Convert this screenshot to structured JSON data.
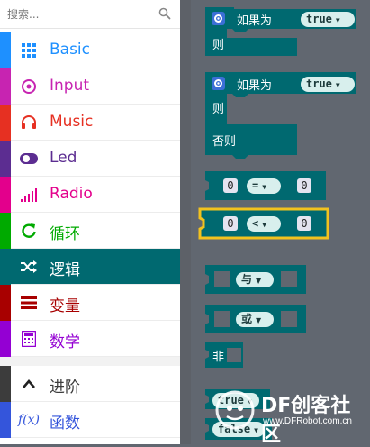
{
  "search": {
    "placeholder": "搜索..."
  },
  "categories": [
    {
      "label": "Basic",
      "color": "#1e90ff",
      "icon": "grid-icon"
    },
    {
      "label": "Input",
      "color": "#c724b1",
      "icon": "target-icon"
    },
    {
      "label": "Music",
      "color": "#e63022",
      "icon": "headphones-icon"
    },
    {
      "label": "Led",
      "color": "#5c2d91",
      "icon": "toggle-icon"
    },
    {
      "label": "Radio",
      "color": "#e3008c",
      "icon": "signal-icon"
    },
    {
      "label": "循环",
      "color": "#00aa00",
      "icon": "refresh-icon"
    },
    {
      "label": "逻辑",
      "color": "#006970",
      "icon": "shuffle-icon"
    },
    {
      "label": "变量",
      "color": "#a80000",
      "icon": "list-icon"
    },
    {
      "label": "数学",
      "color": "#9400d3",
      "icon": "calculator-icon"
    }
  ],
  "advanced": [
    {
      "label": "进阶",
      "color": "#3c3c3c",
      "icon": "chevron-up-icon"
    },
    {
      "label": "函数",
      "color": "#3455db",
      "icon": "function-icon"
    }
  ],
  "blocks": {
    "if1": {
      "if_label": "如果为",
      "then_label": "则",
      "bool": "true"
    },
    "if2": {
      "if_label": "如果为",
      "then_label": "则",
      "else_label": "否则",
      "bool": "true"
    },
    "compare_eq": {
      "left": "0",
      "op": "=",
      "right": "0"
    },
    "compare_lt": {
      "left": "0",
      "op": "<",
      "right": "0"
    },
    "and_block": {
      "op": "与"
    },
    "or_block": {
      "op": "或"
    },
    "not_block": {
      "label": "非"
    },
    "true_block": {
      "label": "true"
    },
    "false_block": {
      "label": "false"
    }
  },
  "colors": {
    "block": "#006970",
    "dropdown": "#d8efed",
    "highlight": "#f2c21e",
    "selected": "#006970"
  },
  "watermark": {
    "title": "DF创客社区",
    "url": "www.DFRobot.com.cn"
  }
}
